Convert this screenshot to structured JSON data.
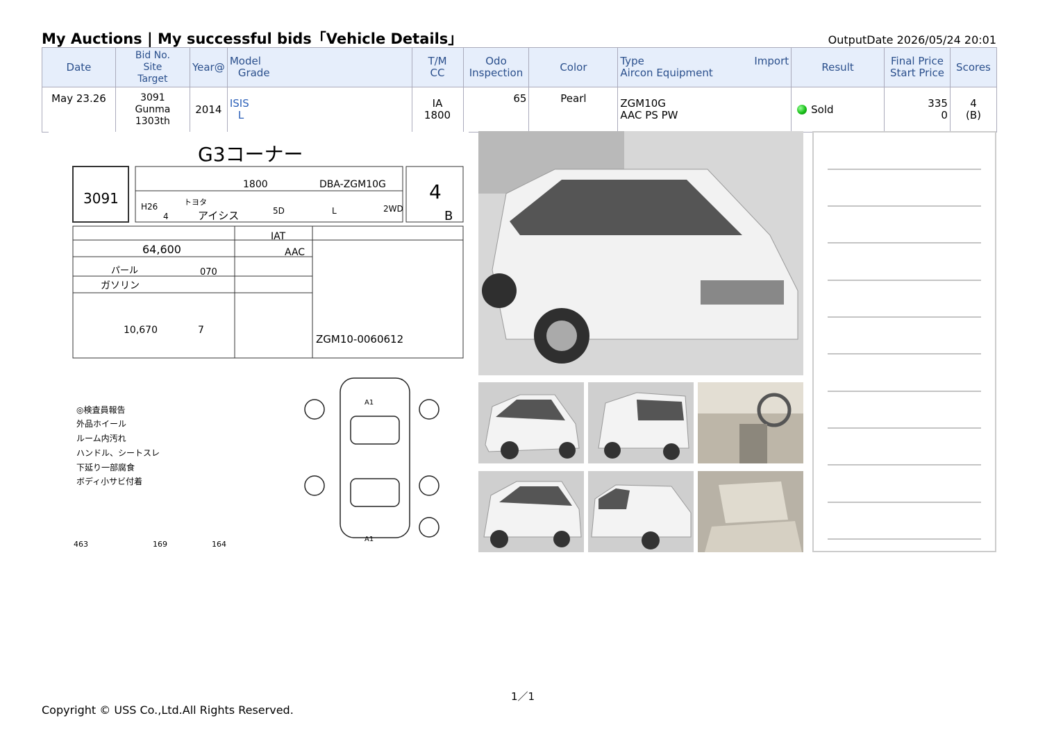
{
  "header": {
    "title": "My Auctions | My successful bids「Vehicle Details」",
    "output_date": "OutputDate  2026/05/24 20:01"
  },
  "table": {
    "headers": {
      "date": "Date",
      "bid_no": "Bid No.",
      "site": "Site",
      "target": "Target",
      "year": "Year@",
      "model": "Model",
      "grade": "Grade",
      "tm": "T/M",
      "cc": "CC",
      "odo": "Odo",
      "inspection": "Inspection",
      "color": "Color",
      "type": "Type",
      "import": "Import",
      "aircon": "Aircon Equipment",
      "result": "Result",
      "final_price": "Final Price",
      "start_price": "Start Price",
      "scores": "Scores"
    },
    "row": {
      "date": "May 23.26",
      "bid_no": "3091",
      "site": "Gunma",
      "target": "1303th",
      "year": "2014",
      "model": "ISIS",
      "grade": "L",
      "tm": "IA",
      "cc": "1800",
      "odo": "65",
      "inspection": "",
      "color": "Pearl",
      "type": "ZGM10G",
      "aircon": "AAC PS PW",
      "result": "Sold",
      "final_price": "335",
      "start_price": "0",
      "score": "4",
      "score_sub": "(B)"
    }
  },
  "sheet": {
    "corner": "G3コーナー",
    "lot": "3091",
    "displacement": "1800",
    "model_code": "DBA-ZGM10G",
    "score": "4",
    "interior": "B",
    "reg_year": "H26",
    "reg_month": "4",
    "maker": "トヨタ",
    "name": "アイシス",
    "doors": "5D",
    "grade": "L",
    "drive": "2WD",
    "shift": "IAT",
    "mileage": "64,600",
    "aircon": "AAC",
    "color": "パール",
    "color_no": "070",
    "fuel": "ガソリン",
    "recycle": "10,670",
    "capacity": "7",
    "chassis": "ZGM10-0060612",
    "report_title": "◎検査員報告",
    "report": [
      "外品ホイール",
      "ルーム内汚れ",
      "ハンドル、シートスレ",
      "下延り一部腐食",
      "ボディ小サビ付着"
    ],
    "length": "463",
    "width": "169",
    "height": "164"
  },
  "footer": {
    "page": "1／1",
    "copyright": "Copyright © USS Co.,Ltd.All Rights Reserved."
  }
}
